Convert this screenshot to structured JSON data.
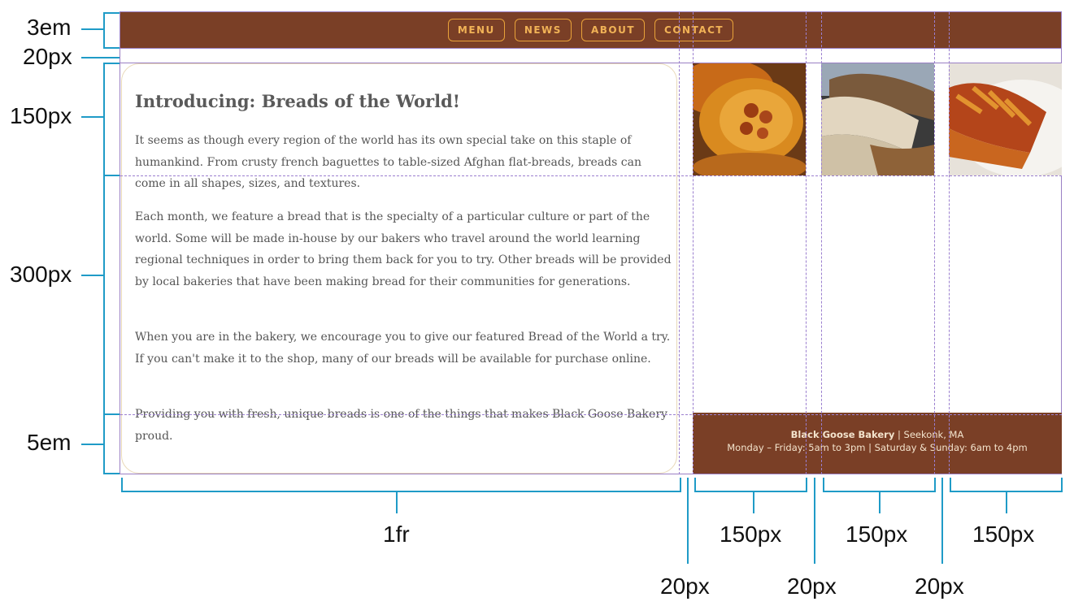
{
  "nav": {
    "items": [
      {
        "label": "MENU"
      },
      {
        "label": "NEWS"
      },
      {
        "label": "ABOUT"
      },
      {
        "label": "CONTACT"
      }
    ]
  },
  "article": {
    "title": "Introducing: Breads of the World!",
    "paragraphs": [
      "It seems as though every region of the world has its own special take on this staple of humankind. From crusty french baguettes to table-sized Afghan flat-breads, breads can come in all shapes, sizes, and textures.",
      "Each month, we feature a bread that is the specialty of a particular culture or part of the world. Some will be made in-house by our bakers who travel around the world learning regional techniques in order to bring them back for you to try. Other breads will be provided by local bakeries that have been making bread for their communities for generations.",
      "When you are in the bakery, we encourage you to give our featured Bread of the World a try. If you can't make it to the shop, many of our breads will be available for purchase online.",
      "Providing you with fresh, unique breads is one of the things that makes Black Goose Bakery proud."
    ]
  },
  "footer": {
    "name": "Black Goose Bakery",
    "location": " | Seekonk, MA",
    "hours": "Monday – Friday: 5am to 3pm | Saturday & Sunday: 6am to 4pm"
  },
  "photos": [
    {
      "icon": "round-bread-photo"
    },
    {
      "icon": "sliced-loaf-photo"
    },
    {
      "icon": "braided-bread-photo"
    }
  ],
  "dimensions": {
    "rows": [
      "3em",
      "20px",
      "150px",
      "300px",
      "5em"
    ],
    "columns": [
      "1fr",
      "150px",
      "150px",
      "150px"
    ],
    "gaps": [
      "20px",
      "20px",
      "20px"
    ]
  },
  "colors": {
    "brand_brown": "#7a3f26",
    "accent_orange": "#f1b256",
    "guide_purple": "#9b7fcf",
    "dimension_blue": "#1f9bc7"
  }
}
